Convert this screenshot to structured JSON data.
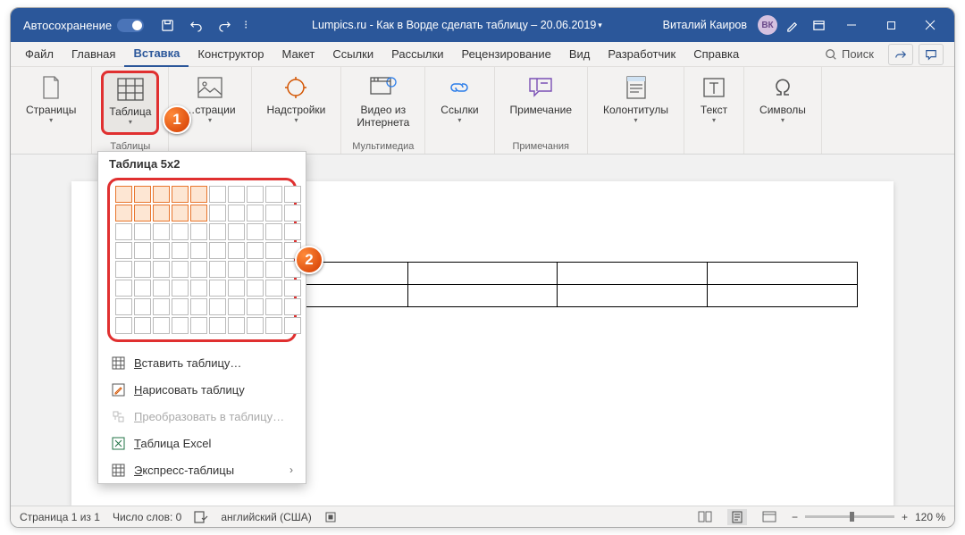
{
  "titlebar": {
    "autosave": "Автосохранение",
    "doc_title": "Lumpics.ru - Как в Ворде сделать таблицу  –  20.06.2019",
    "user_name": "Виталий Каиров",
    "user_initials": "ВК"
  },
  "tabs": {
    "file": "Файл",
    "home": "Главная",
    "insert": "Вставка",
    "design": "Конструктор",
    "layout": "Макет",
    "references": "Ссылки",
    "mailings": "Рассылки",
    "review": "Рецензирование",
    "view": "Вид",
    "developer": "Разработчик",
    "help": "Справка",
    "search": "Поиск"
  },
  "ribbon": {
    "pages": {
      "btn": "Страницы",
      "label": ""
    },
    "tables": {
      "btn": "Таблица",
      "label": "Таблицы"
    },
    "illustrations": {
      "btn": "…страции",
      "label": ""
    },
    "addins": {
      "btn": "Надстройки",
      "label": ""
    },
    "media": {
      "btn1": "Видео из",
      "btn2": "Интернета",
      "label": "Мультимедиа"
    },
    "links": {
      "btn": "Ссылки",
      "label": ""
    },
    "comments": {
      "btn": "Примечание",
      "label": "Примечания"
    },
    "headerfooter": {
      "btn": "Колонтитулы",
      "label": ""
    },
    "text": {
      "btn": "Текст",
      "label": ""
    },
    "symbols": {
      "btn": "Символы",
      "label": ""
    }
  },
  "dropdown": {
    "header": "Таблица 5x2",
    "grid": {
      "cols": 10,
      "rows": 8,
      "sel_cols": 5,
      "sel_rows": 2
    },
    "items": {
      "insert": "Вставить таблицу…",
      "draw": "Нарисовать таблицу",
      "convert": "Преобразовать в таблицу…",
      "excel": "Таблица Excel",
      "quick": "Экспресс-таблицы"
    }
  },
  "statusbar": {
    "page": "Страница 1 из 1",
    "words": "Число слов: 0",
    "lang": "английский (США)",
    "zoom": "120 %"
  },
  "badges": {
    "b1": "1",
    "b2": "2"
  }
}
